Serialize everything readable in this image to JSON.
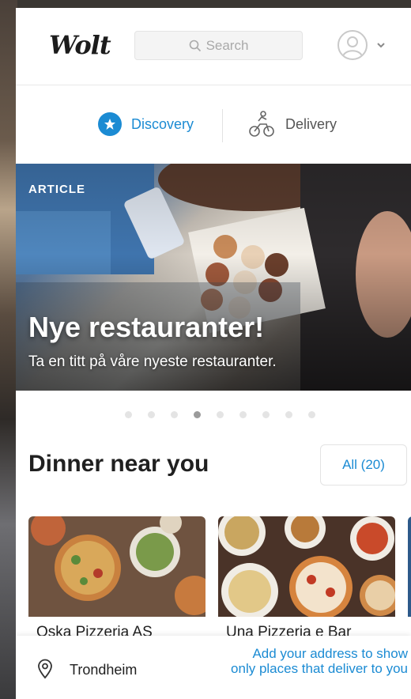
{
  "header": {
    "logo_text": "Wolt",
    "search_placeholder": "Search",
    "icons": {
      "search": "search-icon",
      "avatar": "user-avatar-icon",
      "chevron": "chevron-down-icon"
    }
  },
  "modes": {
    "discovery_label": "Discovery",
    "delivery_label": "Delivery",
    "active": "Discovery",
    "icons": {
      "discovery": "star-badge-icon",
      "delivery": "bicycle-courier-icon"
    }
  },
  "hero": {
    "kicker": "ARTICLE",
    "title": "Nye restauranter!",
    "subtitle": "Ta en titt på våre nyeste restauranter.",
    "carousel_total": 9,
    "carousel_active": 4
  },
  "section": {
    "title": "Dinner near you",
    "all_button": "All (20)"
  },
  "restaurants": [
    {
      "name": "Oska Pizzeria AS"
    },
    {
      "name": "Una Pizzeria e Bar"
    }
  ],
  "footer": {
    "city": "Trondheim",
    "address_cta": "Add your address to show only places that deliver to you",
    "icon": "location-pin-icon"
  },
  "colors": {
    "accent": "#1b8bd3",
    "text": "#202020",
    "muted": "#a9a9a9"
  }
}
